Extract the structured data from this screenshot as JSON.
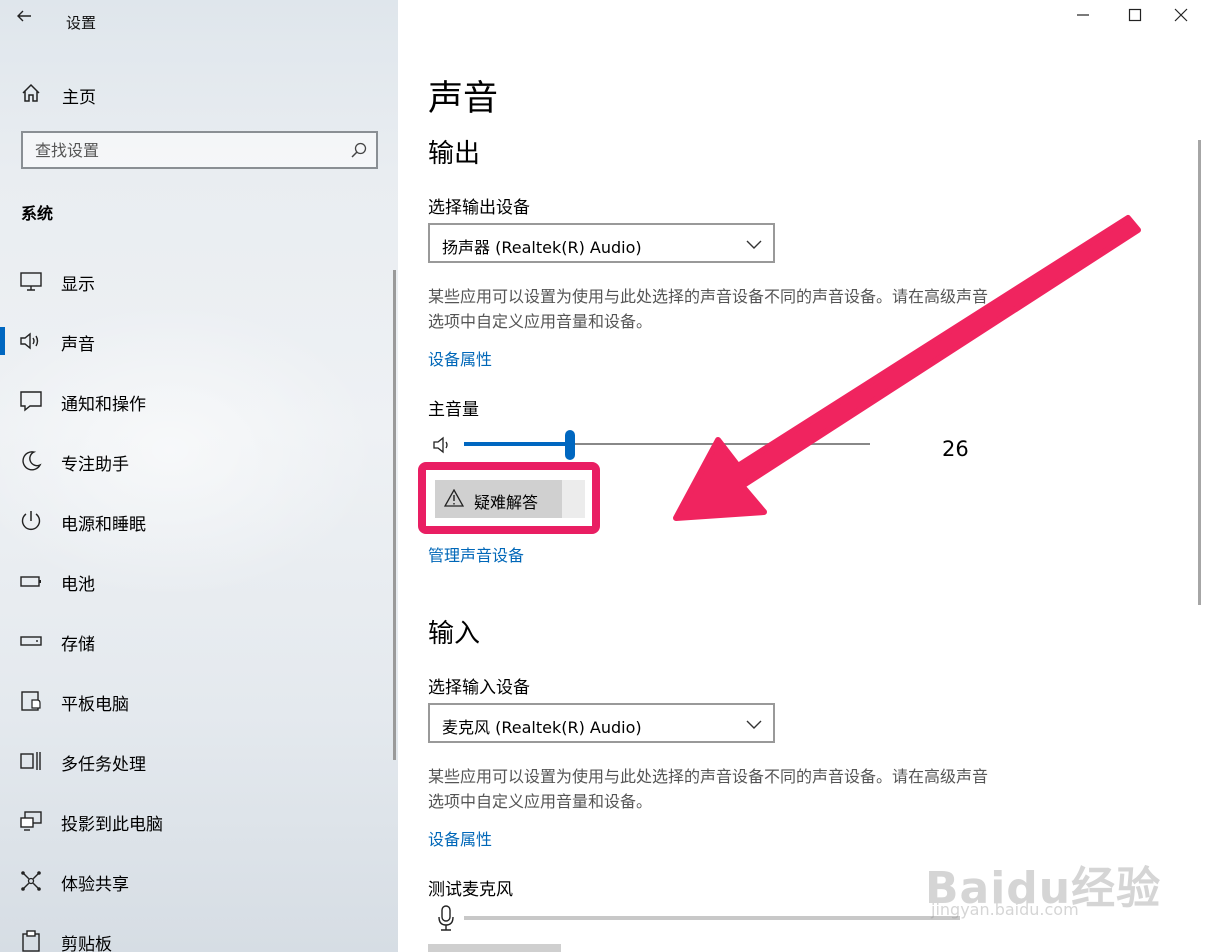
{
  "window": {
    "title": "设置",
    "controls": {
      "minimize": "—",
      "maximize": "☐",
      "close": "✕"
    }
  },
  "sidebar": {
    "back_icon": "←",
    "home_label": "主页",
    "search": {
      "placeholder": "查找设置",
      "value": ""
    },
    "section_label": "系统",
    "items": [
      {
        "label": "显示",
        "icon": "monitor-icon",
        "active": false
      },
      {
        "label": "声音",
        "icon": "speaker-icon",
        "active": true
      },
      {
        "label": "通知和操作",
        "icon": "message-icon",
        "active": false
      },
      {
        "label": "专注助手",
        "icon": "moon-icon",
        "active": false
      },
      {
        "label": "电源和睡眠",
        "icon": "power-icon",
        "active": false
      },
      {
        "label": "电池",
        "icon": "battery-icon",
        "active": false
      },
      {
        "label": "存储",
        "icon": "storage-icon",
        "active": false
      },
      {
        "label": "平板电脑",
        "icon": "tablet-icon",
        "active": false
      },
      {
        "label": "多任务处理",
        "icon": "multitask-icon",
        "active": false
      },
      {
        "label": "投影到此电脑",
        "icon": "project-icon",
        "active": false
      },
      {
        "label": "体验共享",
        "icon": "share-icon",
        "active": false
      },
      {
        "label": "剪贴板",
        "icon": "clipboard-icon",
        "active": false
      }
    ]
  },
  "main": {
    "page_title": "声音",
    "output": {
      "heading": "输出",
      "device_label": "选择输出设备",
      "device_value": "扬声器 (Realtek(R) Audio)",
      "description": "某些应用可以设置为使用与此处选择的声音设备不同的声音设备。请在高级声音选项中自定义应用音量和设备。",
      "properties_link": "设备属性",
      "volume_label": "主音量",
      "volume_value": "26",
      "volume_level": 0.26,
      "troubleshoot_label": "疑难解答",
      "manage_link": "管理声音设备"
    },
    "input": {
      "heading": "输入",
      "device_label": "选择输入设备",
      "device_value": "麦克风 (Realtek(R) Audio)",
      "description": "某些应用可以设置为使用与此处选择的声音设备不同的声音设备。请在高级声音选项中自定义应用音量和设备。",
      "properties_link": "设备属性",
      "test_label": "测试麦克风",
      "mic_level": 0
    }
  },
  "annotation": {
    "highlight_color": "#e91e63",
    "arrow_color": "#f0245f"
  },
  "watermark": {
    "text": "Baidu经验",
    "sub": "jingyan.baidu.com"
  },
  "accent_color": "#0067c0",
  "link_color": "#0067b8"
}
